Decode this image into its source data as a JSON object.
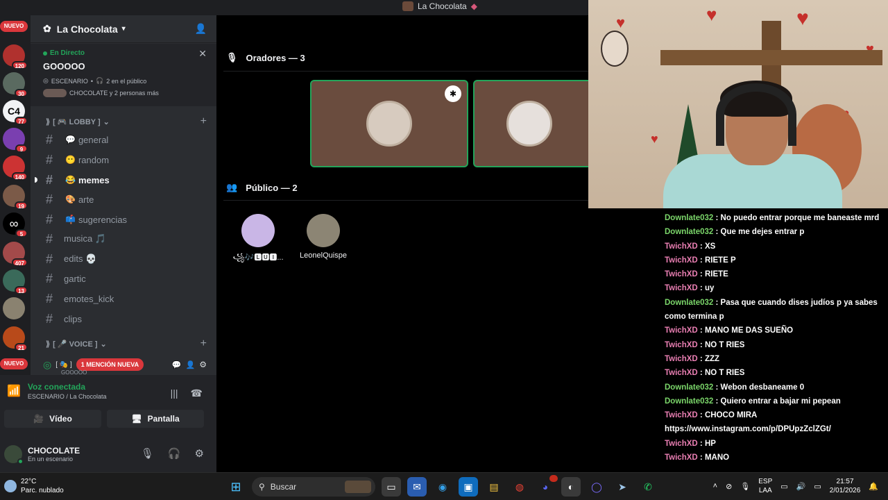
{
  "window": {
    "title": "La Chocolata"
  },
  "rail": {
    "badges": [
      "120",
      "30",
      "77",
      "9",
      "140",
      "19",
      "5",
      "407",
      "13",
      "21"
    ],
    "nuevo_label": "NUEVO"
  },
  "guild": {
    "name": "La Chocolata"
  },
  "live": {
    "label": "En Directo",
    "title": "GOOOOO",
    "stage_line": "ESCENARIO",
    "audience_count": "2 en el público",
    "participants": "CHOCOLATE y 2 personas más"
  },
  "categories": {
    "lobby": "[ 🎮 LOBBY ]",
    "voice": "[ 🎤 VOICE ]"
  },
  "channels": [
    {
      "emoji": "💬",
      "name": "general"
    },
    {
      "emoji": "😶",
      "name": "random"
    },
    {
      "emoji": "😂",
      "name": "memes"
    },
    {
      "emoji": "🎨",
      "name": "arte"
    },
    {
      "emoji": "📫",
      "name": "sugerencias"
    },
    {
      "emoji": "",
      "name": "musica 🎵"
    },
    {
      "emoji": "",
      "name": "edits 💀"
    },
    {
      "emoji": "",
      "name": "gartic"
    },
    {
      "emoji": "",
      "name": "emotes_kick"
    },
    {
      "emoji": "",
      "name": "clips"
    }
  ],
  "voice_row": {
    "mention": "1 MENCIÓN NUEVA",
    "sub": "GOOOOO"
  },
  "panel": {
    "voice_status": "Voz conectada",
    "voice_location": "ESCENARIO / La Chocolata",
    "video_label": "Vídeo",
    "screen_label": "Pantalla",
    "user_name": "CHOCOLATE",
    "user_status": "En un escenario"
  },
  "stage": {
    "speakers_header": "Oradores — 3",
    "audience_header": "Público — 2",
    "audience": [
      {
        "name": "꧁🎶🅻🆄🅸...",
        "color": "#c9b6e6"
      },
      {
        "name": "LeonelQuispe",
        "color": "#8c8574"
      }
    ]
  },
  "chat": [
    {
      "user": "Downlate032",
      "text": "No puedo entrar porque me baneaste mrd",
      "kind": "d"
    },
    {
      "user": "Downlate032",
      "text": "Que me dejes entrar p",
      "kind": "d"
    },
    {
      "user": "TwichXD",
      "text": "XS",
      "kind": "t"
    },
    {
      "user": "TwichXD",
      "text": "RIETE P",
      "kind": "t"
    },
    {
      "user": "TwichXD",
      "text": "RIETE",
      "kind": "t"
    },
    {
      "user": "TwichXD",
      "text": "uy",
      "kind": "t"
    },
    {
      "user": "Downlate032",
      "text": "Pasa que cuando dises judíos p ya sabes como termina p",
      "kind": "d"
    },
    {
      "user": "TwichXD",
      "text": "MANO ME DAS SUEÑO",
      "kind": "t"
    },
    {
      "user": "TwichXD",
      "text": "NO T RIES",
      "kind": "t"
    },
    {
      "user": "TwichXD",
      "text": "ZZZ",
      "kind": "t"
    },
    {
      "user": "TwichXD",
      "text": "NO T RIES",
      "kind": "t"
    },
    {
      "user": "Downlate032",
      "text": "Webon desbaneame 0",
      "kind": "d"
    },
    {
      "user": "Downlate032",
      "text": "Quiero entrar a bajar mi pepean",
      "kind": "d"
    },
    {
      "user": "TwichXD",
      "text": "CHOCO MIRA https://www.instagram.com/p/DPUpzZclZGt/",
      "kind": "t"
    },
    {
      "user": "TwichXD",
      "text": "HP",
      "kind": "t"
    },
    {
      "user": "TwichXD",
      "text": "MANO",
      "kind": "t"
    }
  ],
  "taskbar": {
    "temp": "22°C",
    "weather": "Parc. nublado",
    "search": "Buscar",
    "lang_top": "ESP",
    "lang_bottom": "LAA",
    "time": "21:57",
    "date": "2/01/2026"
  }
}
